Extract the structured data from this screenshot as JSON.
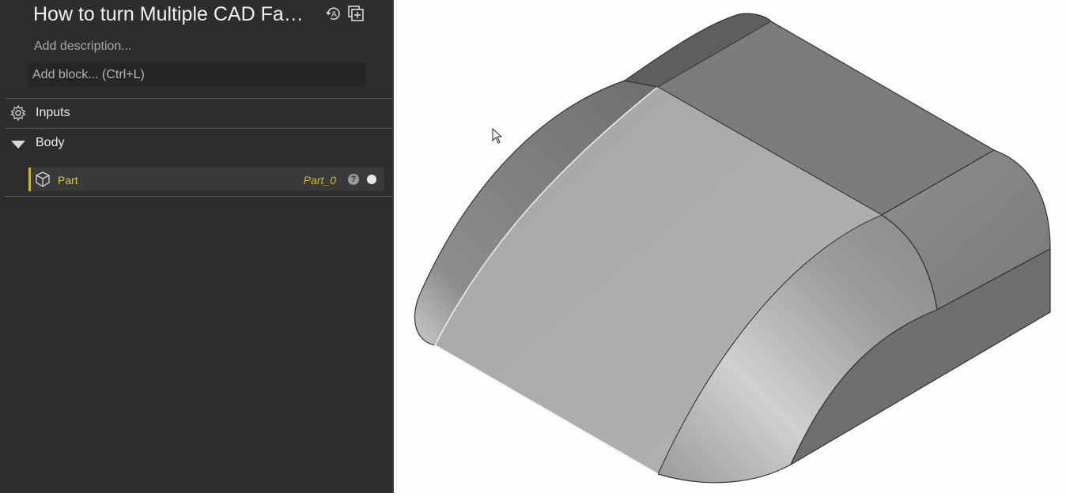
{
  "document": {
    "title": "How to turn Multiple CAD Fa…",
    "description_placeholder": "Add description...",
    "add_block_placeholder": "Add block... (Ctrl+L)"
  },
  "tree": {
    "inputs_label": "Inputs",
    "body_label": "Body",
    "part": {
      "label": "Part",
      "variable": "Part_0",
      "help": "?"
    }
  },
  "colors": {
    "panel_bg": "#2d2d2d",
    "accent": "#c8b83a",
    "viewport_bg": "#fdfdfc"
  },
  "icons": [
    "autograph-refresh-icon",
    "add-copy-icon",
    "inputs-gear-icon",
    "caret-down-icon",
    "part-cube-icon",
    "help-icon",
    "visibility-dot-icon",
    "cursor-arrow-icon"
  ]
}
